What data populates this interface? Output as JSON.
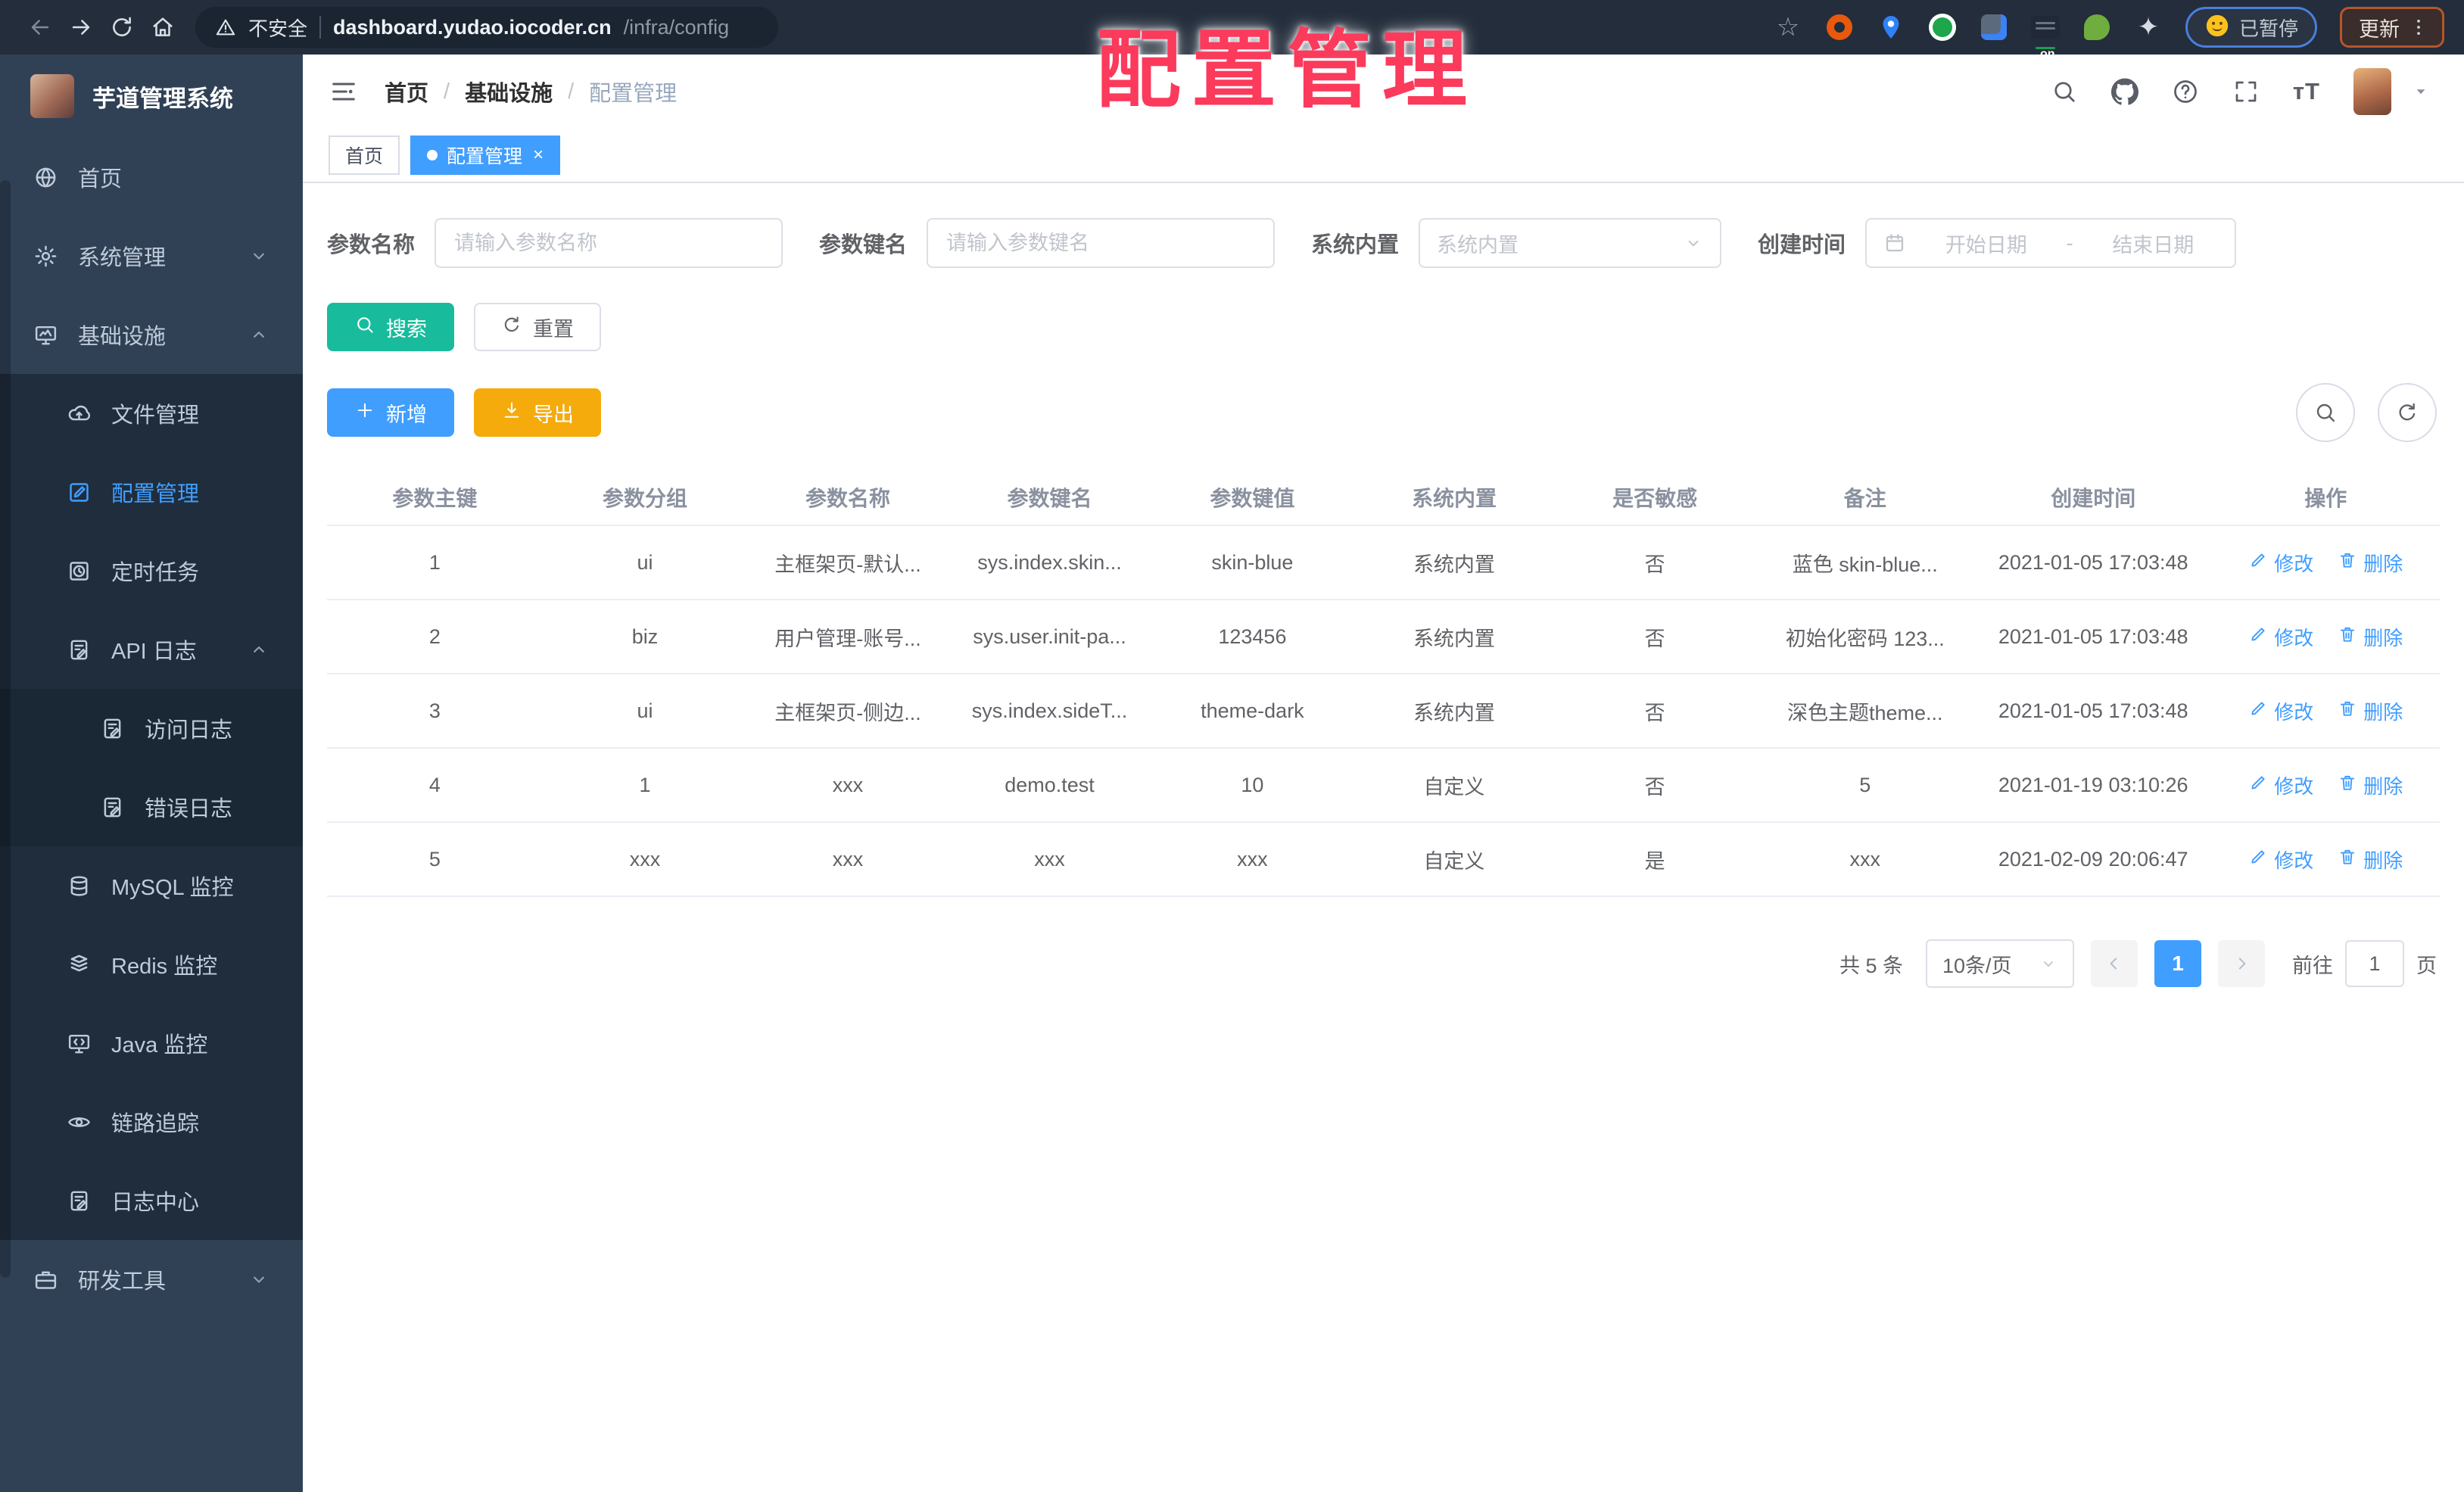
{
  "browser": {
    "security_label": "不安全",
    "url_host": "dashboard.yudao.iocoder.cn",
    "url_path": "/infra/config",
    "paused_label": "已暂停",
    "update_label": "更新",
    "extensions": [
      {
        "name": "bookmark-star-icon",
        "style": "glyph",
        "glyph": "☆"
      },
      {
        "name": "ext-orange-ring-icon",
        "style": "ring",
        "color": "#e8590c"
      },
      {
        "name": "ext-blue-pin-icon",
        "style": "pin",
        "color": "#2f81f7"
      },
      {
        "name": "ext-green-circle-icon",
        "style": "ring2",
        "color": "#1ea64d"
      },
      {
        "name": "ext-slate-square-icon",
        "style": "square",
        "color": "#5b6b7d"
      },
      {
        "name": "ext-on-badge-icon",
        "style": "badge",
        "badge": "on",
        "badge_color": "#17a24a"
      },
      {
        "name": "ext-green-leaf-icon",
        "style": "leaf",
        "color": "#6fae3e"
      },
      {
        "name": "ext-white-star-icon",
        "style": "star",
        "glyph": "✦"
      }
    ]
  },
  "overlay_title": "配置管理",
  "sidebar": {
    "logo_title": "芋道管理系统",
    "items": [
      {
        "id": "home",
        "label": "首页",
        "icon": "globe",
        "level": 1
      },
      {
        "id": "system",
        "label": "系统管理",
        "icon": "gear",
        "level": 1,
        "chevron": "down"
      },
      {
        "id": "infra",
        "label": "基础设施",
        "icon": "monitor",
        "level": 1,
        "chevron": "up"
      },
      {
        "id": "file",
        "label": "文件管理",
        "icon": "cloud",
        "level": 2
      },
      {
        "id": "config",
        "label": "配置管理",
        "icon": "edit",
        "level": 2,
        "active": true
      },
      {
        "id": "job",
        "label": "定时任务",
        "icon": "clock",
        "level": 2
      },
      {
        "id": "api-log",
        "label": "API 日志",
        "icon": "logpen",
        "level": 2,
        "chevron": "up"
      },
      {
        "id": "access-log",
        "label": "访问日志",
        "icon": "logpen",
        "level": 3
      },
      {
        "id": "error-log",
        "label": "错误日志",
        "icon": "logpen",
        "level": 3
      },
      {
        "id": "mysql",
        "label": "MySQL 监控",
        "icon": "mysql",
        "level": 2
      },
      {
        "id": "redis",
        "label": "Redis 监控",
        "icon": "redis",
        "level": 2
      },
      {
        "id": "java",
        "label": "Java 监控",
        "icon": "java",
        "level": 2
      },
      {
        "id": "trace",
        "label": "链路追踪",
        "icon": "eye",
        "level": 2
      },
      {
        "id": "log-center",
        "label": "日志中心",
        "icon": "logpen",
        "level": 2
      },
      {
        "id": "dev-tools",
        "label": "研发工具",
        "icon": "tools",
        "level": 1,
        "chevron": "down"
      }
    ]
  },
  "navbar": {
    "breadcrumb": [
      "首页",
      "基础设施",
      "配置管理"
    ]
  },
  "tags": [
    {
      "label": "首页",
      "active": false,
      "closable": false
    },
    {
      "label": "配置管理",
      "active": true,
      "closable": true
    }
  ],
  "filters": {
    "name_label": "参数名称",
    "name_placeholder": "请输入参数名称",
    "key_label": "参数键名",
    "key_placeholder": "请输入参数键名",
    "type_label": "系统内置",
    "type_placeholder": "系统内置",
    "date_label": "创建时间",
    "date_start_placeholder": "开始日期",
    "date_separator": "-",
    "date_end_placeholder": "结束日期"
  },
  "actions": {
    "search_label": "搜索",
    "reset_label": "重置",
    "add_label": "新增",
    "export_label": "导出"
  },
  "table": {
    "columns": [
      "参数主键",
      "参数分组",
      "参数名称",
      "参数键名",
      "参数键值",
      "系统内置",
      "是否敏感",
      "备注",
      "创建时间",
      "操作"
    ],
    "rows": [
      {
        "id": "1",
        "group": "ui",
        "name": "主框架页-默认...",
        "key": "sys.index.skin...",
        "value": "skin-blue",
        "type": "系统内置",
        "sensitive": "否",
        "remark": "蓝色 skin-blue...",
        "created": "2021-01-05 17:03:48"
      },
      {
        "id": "2",
        "group": "biz",
        "name": "用户管理-账号...",
        "key": "sys.user.init-pa...",
        "value": "123456",
        "type": "系统内置",
        "sensitive": "否",
        "remark": "初始化密码 123...",
        "created": "2021-01-05 17:03:48"
      },
      {
        "id": "3",
        "group": "ui",
        "name": "主框架页-侧边...",
        "key": "sys.index.sideT...",
        "value": "theme-dark",
        "type": "系统内置",
        "sensitive": "否",
        "remark": "深色主题theme...",
        "created": "2021-01-05 17:03:48"
      },
      {
        "id": "4",
        "group": "1",
        "name": "xxx",
        "key": "demo.test",
        "value": "10",
        "type": "自定义",
        "sensitive": "否",
        "remark": "5",
        "created": "2021-01-19 03:10:26"
      },
      {
        "id": "5",
        "group": "xxx",
        "name": "xxx",
        "key": "xxx",
        "value": "xxx",
        "type": "自定义",
        "sensitive": "是",
        "remark": "xxx",
        "created": "2021-02-09 20:06:47"
      }
    ],
    "edit_label": "修改",
    "delete_label": "删除"
  },
  "pagination": {
    "total_label": "共 5 条",
    "page_size_label": "10条/页",
    "current_page": "1",
    "goto_label": "前往",
    "goto_value": "1",
    "page_unit_label": "页"
  },
  "colors": {
    "primary": "#409eff",
    "search_button": "#18bc9c",
    "export_button": "#f5ab0c",
    "overlay_red": "#fb3a5c",
    "sidebar_bg": "#304156",
    "sidebar_submenu_bg": "#1f2d3d",
    "chrome_bg": "#232d3b"
  }
}
